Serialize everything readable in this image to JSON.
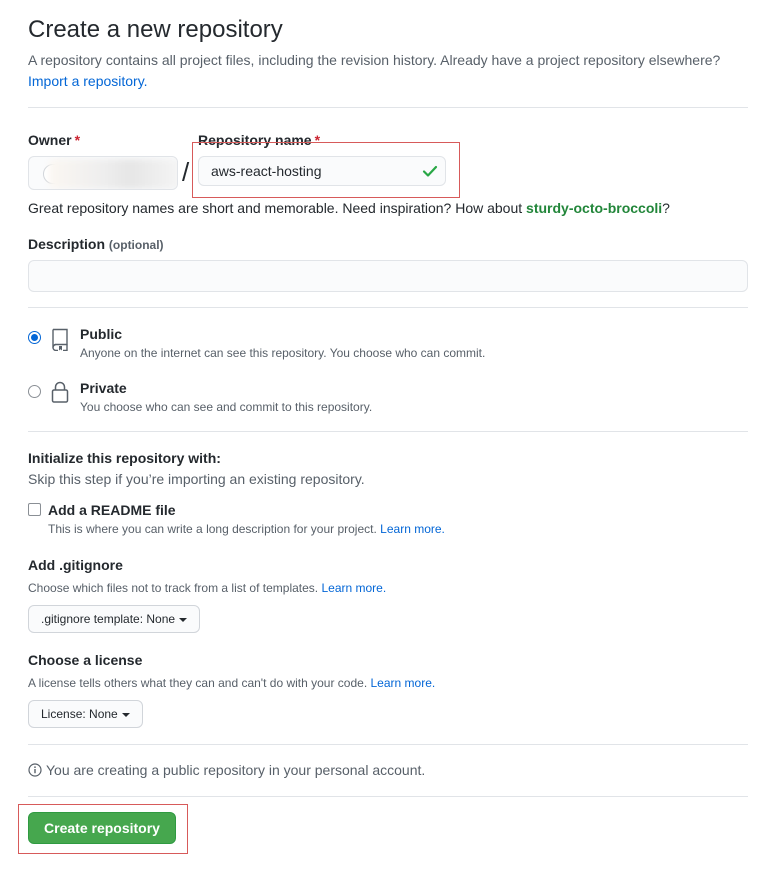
{
  "header": {
    "title": "Create a new repository",
    "subtitle": "A repository contains all project files, including the revision history. Already have a project repository elsewhere?",
    "import_link": "Import a repository."
  },
  "owner": {
    "label": "Owner",
    "required_mark": "*"
  },
  "repo_name": {
    "label": "Repository name",
    "required_mark": "*",
    "value": "aws-react-hosting",
    "separator": "/",
    "status_icon": "check-icon"
  },
  "hint": {
    "text": "Great repository names are short and memorable. Need inspiration? How about",
    "suggestion": "sturdy-octo-broccoli",
    "end": "?"
  },
  "description": {
    "label": "Description",
    "optional": "(optional)",
    "value": ""
  },
  "visibility": {
    "public": {
      "title": "Public",
      "desc": "Anyone on the internet can see this repository. You choose who can commit.",
      "selected": true,
      "icon": "repo-icon"
    },
    "private": {
      "title": "Private",
      "desc": "You choose who can see and commit to this repository.",
      "selected": false,
      "icon": "lock-icon"
    }
  },
  "init": {
    "title": "Initialize this repository with:",
    "subtitle": "Skip this step if you’re importing an existing repository.",
    "readme": {
      "label": "Add a README file",
      "desc": "This is where you can write a long description for your project.",
      "link": "Learn more.",
      "checked": false
    },
    "gitignore": {
      "title": "Add .gitignore",
      "desc": "Choose which files not to track from a list of templates.",
      "link": "Learn more.",
      "button": ".gitignore template: None"
    },
    "license": {
      "title": "Choose a license",
      "desc": "A license tells others what they can and can't do with your code.",
      "link": "Learn more.",
      "button": "License: None"
    }
  },
  "info": {
    "text": "You are creating a public repository in your personal account.",
    "icon": "info-icon"
  },
  "submit": {
    "label": "Create repository"
  },
  "colors": {
    "link": "#0366d6",
    "accent_green": "#46a74e",
    "suggestion_green": "#22863a",
    "highlight_red": "#d75a5a",
    "required_red": "#cb2431"
  }
}
